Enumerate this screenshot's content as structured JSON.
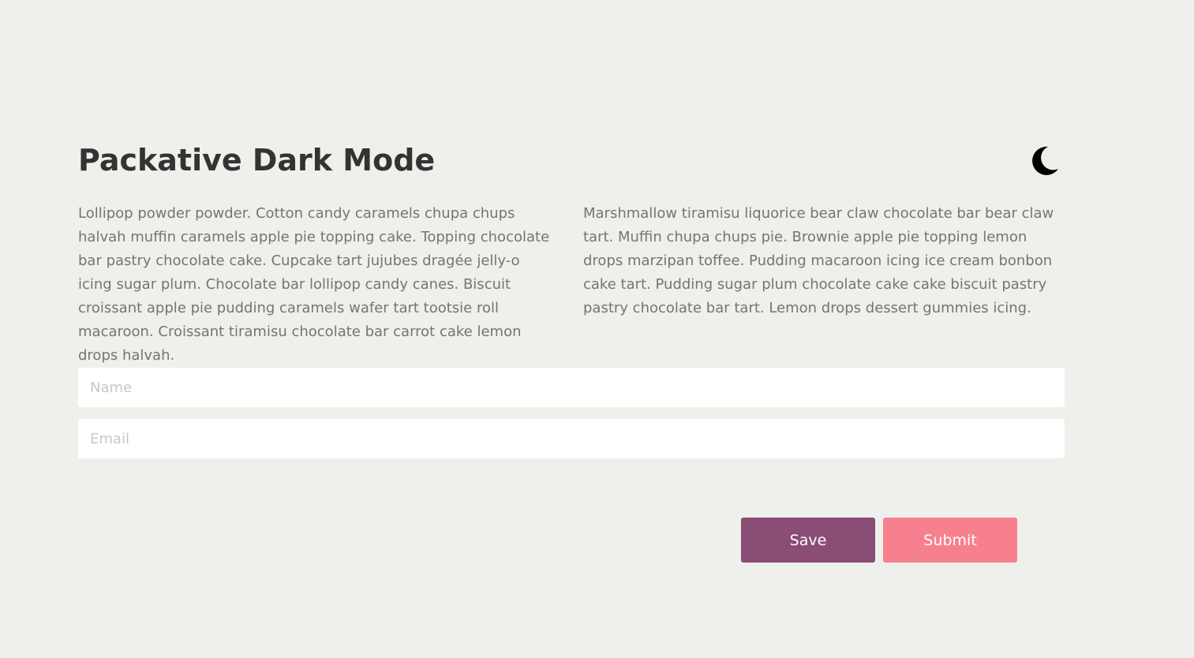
{
  "header": {
    "title": "Packative Dark Mode",
    "theme_toggle_icon": "moon-icon"
  },
  "content": {
    "paragraph_left": "Lollipop powder powder. Cotton candy caramels chupa chups halvah muffin caramels apple pie topping cake. Topping chocolate bar pastry chocolate cake. Cupcake tart jujubes dragée jelly-o icing sugar plum. Chocolate bar lollipop candy canes. Biscuit croissant apple pie pudding caramels wafer tart tootsie roll macaroon. Croissant tiramisu chocolate bar carrot cake lemon drops halvah.",
    "paragraph_right": "Marshmallow tiramisu liquorice bear claw chocolate bar bear claw tart. Muffin chupa chups pie. Brownie apple pie topping lemon drops marzipan toffee. Pudding macaroon icing ice cream bonbon cake tart. Pudding sugar plum chocolate cake cake biscuit pastry pastry chocolate bar tart. Lemon drops dessert gummies icing."
  },
  "form": {
    "name": {
      "value": "",
      "placeholder": "Name"
    },
    "email": {
      "value": "",
      "placeholder": "Email"
    },
    "save_label": "Save",
    "submit_label": "Submit"
  },
  "colors": {
    "background": "#efefeb",
    "heading": "#333333",
    "body_text": "#76766a",
    "save_button": "#8a4d76",
    "submit_button": "#f7808f"
  }
}
